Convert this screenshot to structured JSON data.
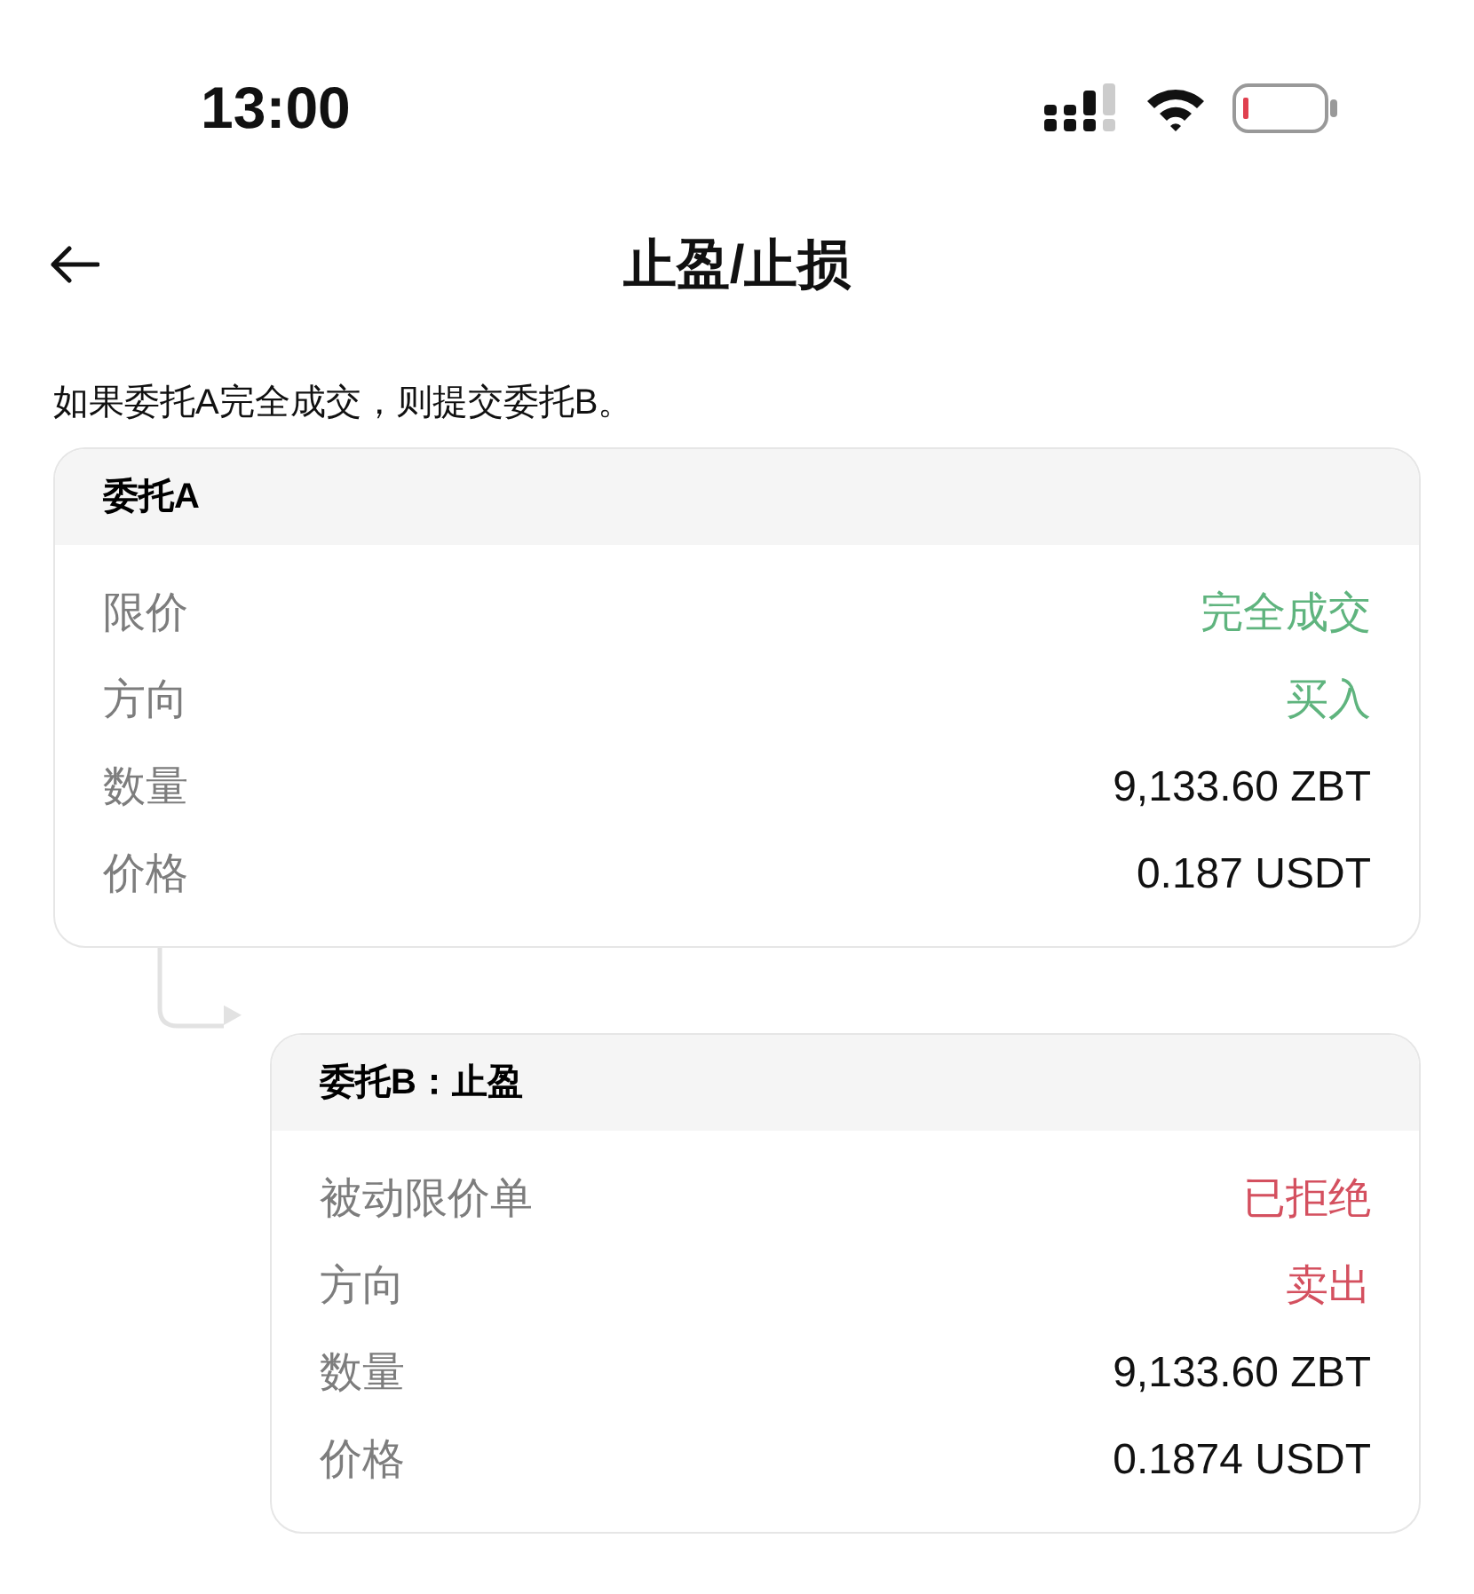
{
  "status_bar": {
    "time": "13:00"
  },
  "header": {
    "title": "止盈/止损"
  },
  "description": "如果委托A完全成交，则提交委托B。",
  "orders": [
    {
      "title": "委托A",
      "rows": [
        {
          "label": "限价",
          "value": "完全成交",
          "color": "#5fb47e"
        },
        {
          "label": "方向",
          "value": "买入",
          "color": "#5fb47e"
        },
        {
          "label": "数量",
          "value": "9,133.60 ZBT"
        },
        {
          "label": "价格",
          "value": "0.187 USDT"
        }
      ]
    },
    {
      "title": "委托B：止盈",
      "rows": [
        {
          "label": "被动限价单",
          "value": "已拒绝",
          "color": "#d4505f"
        },
        {
          "label": "方向",
          "value": "卖出",
          "color": "#d4505f"
        },
        {
          "label": "数量",
          "value": "9,133.60 ZBT"
        },
        {
          "label": "价格",
          "value": "0.1874 USDT"
        }
      ]
    }
  ]
}
